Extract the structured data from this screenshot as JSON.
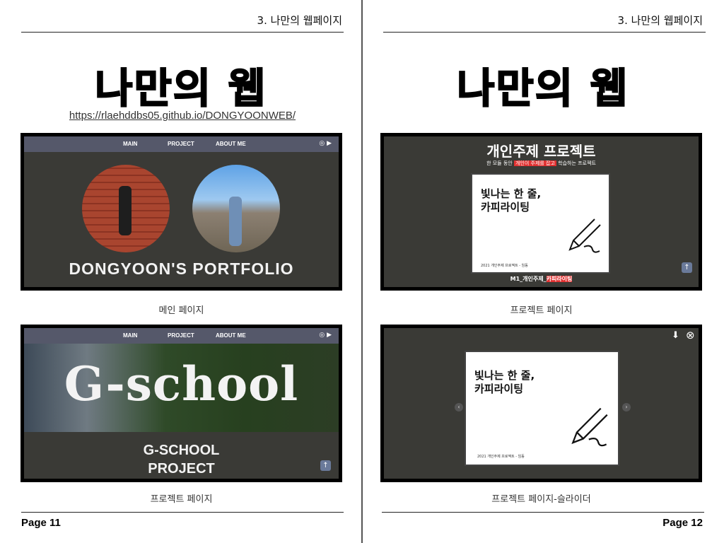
{
  "left_page": {
    "section_header": "3.  나만의 웹페이지",
    "title": "나만의 웹",
    "url": "https://rlaehddbs05.github.io/DONGYOONWEB/",
    "shot_main": {
      "nav": [
        "MAIN",
        "PROJECT",
        "ABOUT ME"
      ],
      "nav_icons": "◎ ▶",
      "title": "DONGYOON'S PORTFOLIO"
    },
    "caption_main": "메인 페이지",
    "shot_gschool": {
      "nav": [
        "MAIN",
        "PROJECT",
        "ABOUT ME"
      ],
      "nav_icons": "◎ ▶",
      "big_text": "G-school",
      "sub_line1": "G-SCHOOL",
      "sub_line2": "PROJECT",
      "up": "↑"
    },
    "caption_gschool": "프로젝트 페이지",
    "page_number": "Page 11"
  },
  "right_page": {
    "section_header": "3.  나만의 웹페이지",
    "title": "나만의 웹",
    "shot_project": {
      "title": "개인주제 프로젝트",
      "sub_before": "한 모듈 동안 ",
      "sub_highlight": "개인이 주제를 잡고",
      "sub_after": " 학습하는 프로젝트",
      "card_line1": "빛나는 한 줄,",
      "card_line2": "카피라이팅",
      "card_foot": "2021 개인주제 프로젝트 - 임동",
      "bar_before": "M1_개인주제_",
      "bar_highlight": "카피라이팅",
      "up": "↑"
    },
    "caption_project": "프로젝트 페이지",
    "shot_slider": {
      "card_line1": "빛나는 한 줄,",
      "card_line2": "카피라이팅",
      "card_foot": "2021 개인주제 프로젝트 - 임동",
      "prev": "‹",
      "next": "›",
      "download": "⬇",
      "close": "⊗"
    },
    "caption_slider": "프로젝트 페이지-슬라이더",
    "page_number": "Page 12"
  }
}
